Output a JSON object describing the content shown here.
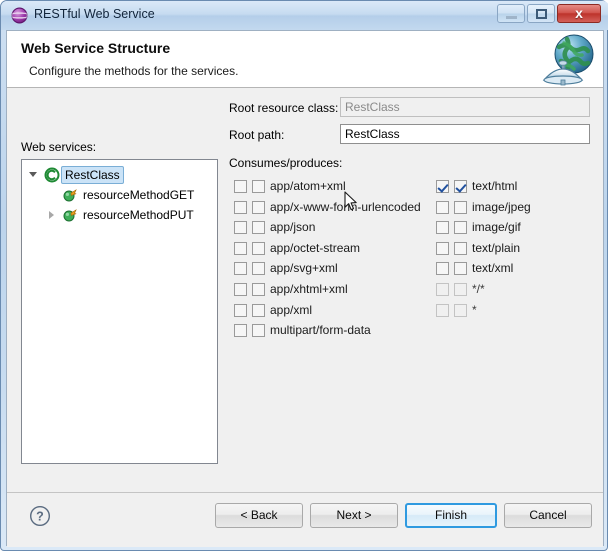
{
  "window": {
    "title": "RESTful Web Service",
    "app_icon": "purple-sphere-icon",
    "controls": {
      "minimize": "–",
      "maximize": "□",
      "close": "x"
    }
  },
  "banner": {
    "title": "Web Service Structure",
    "subtitle": "Configure the methods for the services.",
    "icon": "globe-satellite-dish-icon"
  },
  "content": {
    "tree_label": "Web services:",
    "tree": [
      {
        "label": "RestClass",
        "icon": "java-class-icon",
        "twisty": "open",
        "indent": 0,
        "selected": true
      },
      {
        "label": "resourceMethodGET",
        "icon": "java-method-icon",
        "twisty": "none",
        "indent": 1,
        "selected": false
      },
      {
        "label": "resourceMethodPUT",
        "icon": "java-method-icon",
        "twisty": "closed",
        "indent": 1,
        "selected": false
      }
    ],
    "root_resource_class": {
      "label": "Root resource class:",
      "value": "RestClass",
      "enabled": false
    },
    "root_path": {
      "label": "Root path:",
      "value": "RestClass",
      "enabled": true
    },
    "consumes_produces_label": "Consumes/produces:",
    "mime_left": [
      {
        "label": "app/atom+xml",
        "consumes": false,
        "produces": false,
        "enabled": true
      },
      {
        "label": "app/x-www-form-urlencoded",
        "consumes": false,
        "produces": false,
        "enabled": true
      },
      {
        "label": "app/json",
        "consumes": false,
        "produces": false,
        "enabled": true
      },
      {
        "label": "app/octet-stream",
        "consumes": false,
        "produces": false,
        "enabled": true
      },
      {
        "label": "app/svg+xml",
        "consumes": false,
        "produces": false,
        "enabled": true
      },
      {
        "label": "app/xhtml+xml",
        "consumes": false,
        "produces": false,
        "enabled": true
      },
      {
        "label": "app/xml",
        "consumes": false,
        "produces": false,
        "enabled": true
      },
      {
        "label": "multipart/form-data",
        "consumes": false,
        "produces": false,
        "enabled": true
      }
    ],
    "mime_right": [
      {
        "label": "text/html",
        "consumes": true,
        "produces": true,
        "enabled": true
      },
      {
        "label": "image/jpeg",
        "consumes": false,
        "produces": false,
        "enabled": true
      },
      {
        "label": "image/gif",
        "consumes": false,
        "produces": false,
        "enabled": true
      },
      {
        "label": "text/plain",
        "consumes": false,
        "produces": false,
        "enabled": true
      },
      {
        "label": "text/xml",
        "consumes": false,
        "produces": false,
        "enabled": true
      },
      {
        "label": "*/*",
        "consumes": false,
        "produces": false,
        "enabled": false
      },
      {
        "label": "*",
        "consumes": false,
        "produces": false,
        "enabled": false
      }
    ]
  },
  "footer": {
    "help": "?",
    "back": "< Back",
    "next": "Next >",
    "finish": "Finish",
    "cancel": "Cancel"
  },
  "colors": {
    "accent": "#2f9ae0",
    "check": "#21519e",
    "selection": "#cbe3f7",
    "dialog_bg": "#f0f0f0",
    "close_button": "#bd332b"
  }
}
